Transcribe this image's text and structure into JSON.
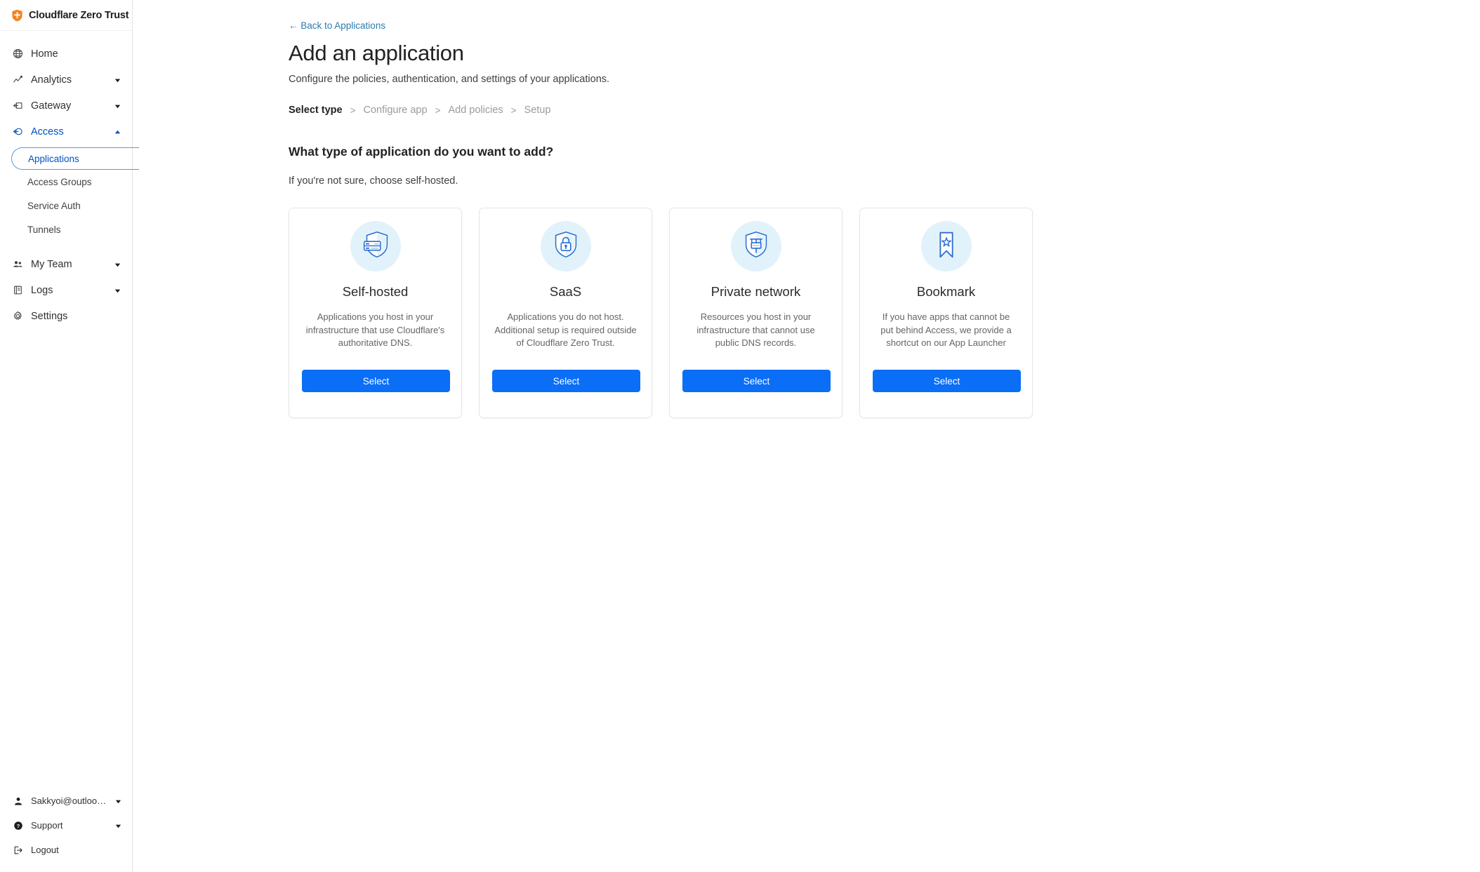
{
  "brand": {
    "name": "Cloudflare Zero Trust",
    "logo_icon": "cloudflare-shield-icon"
  },
  "sidebar": {
    "items": [
      {
        "label": "Home",
        "icon": "globe-icon",
        "expandable": false
      },
      {
        "label": "Analytics",
        "icon": "analytics-line-chart-icon",
        "expandable": true
      },
      {
        "label": "Gateway",
        "icon": "gateway-arrow-box-icon",
        "expandable": true
      },
      {
        "label": "Access",
        "icon": "access-arrow-circle-icon",
        "expandable": true,
        "active": true
      }
    ],
    "access_children": [
      {
        "label": "Applications",
        "selected": true
      },
      {
        "label": "Access Groups",
        "selected": false
      },
      {
        "label": "Service Auth",
        "selected": false
      },
      {
        "label": "Tunnels",
        "selected": false
      }
    ],
    "items_after": [
      {
        "label": "My Team",
        "icon": "team-people-icon",
        "expandable": true
      },
      {
        "label": "Logs",
        "icon": "logs-book-icon",
        "expandable": true
      },
      {
        "label": "Settings",
        "icon": "gear-icon",
        "expandable": false
      }
    ],
    "bottom": [
      {
        "label": "Sakkyoi@outlook.c...",
        "icon": "user-avatar-icon",
        "expandable": true
      },
      {
        "label": "Support",
        "icon": "help-circle-icon",
        "expandable": true
      },
      {
        "label": "Logout",
        "icon": "logout-arrow-icon",
        "expandable": false
      }
    ]
  },
  "header": {
    "back_link": "← Back to Applications",
    "title": "Add an application",
    "subtitle": "Configure the policies, authentication, and settings of your applications."
  },
  "steps": {
    "separator": ">",
    "items": [
      {
        "label": "Select type",
        "current": true
      },
      {
        "label": "Configure app",
        "current": false
      },
      {
        "label": "Add policies",
        "current": false
      },
      {
        "label": "Setup",
        "current": false
      }
    ]
  },
  "section": {
    "title": "What type of application do you want to add?",
    "hint": "If you're not sure, choose self-hosted."
  },
  "cards": [
    {
      "title": "Self-hosted",
      "description": "Applications you host in your infrastructure that use Cloudflare's authoritative DNS.",
      "button": "Select",
      "icon": "shield-server-icon"
    },
    {
      "title": "SaaS",
      "description": "Applications you do not host. Additional setup is required outside of Cloudflare Zero Trust.",
      "button": "Select",
      "icon": "shield-lock-icon"
    },
    {
      "title": "Private network",
      "description": "Resources you host in your infrastructure that cannot use public DNS records.",
      "button": "Select",
      "icon": "shield-network-icon"
    },
    {
      "title": "Bookmark",
      "description": "If you have apps that cannot be put behind Access, we provide a shortcut on our App Launcher",
      "button": "Select",
      "icon": "bookmark-star-icon"
    }
  ],
  "colors": {
    "accent_blue": "#0a6ef7",
    "link_blue": "#2c7cb0",
    "active_nav_blue": "#0051c3",
    "icon_circle_bg": "#e2f2fb",
    "brand_orange": "#f6821f"
  }
}
